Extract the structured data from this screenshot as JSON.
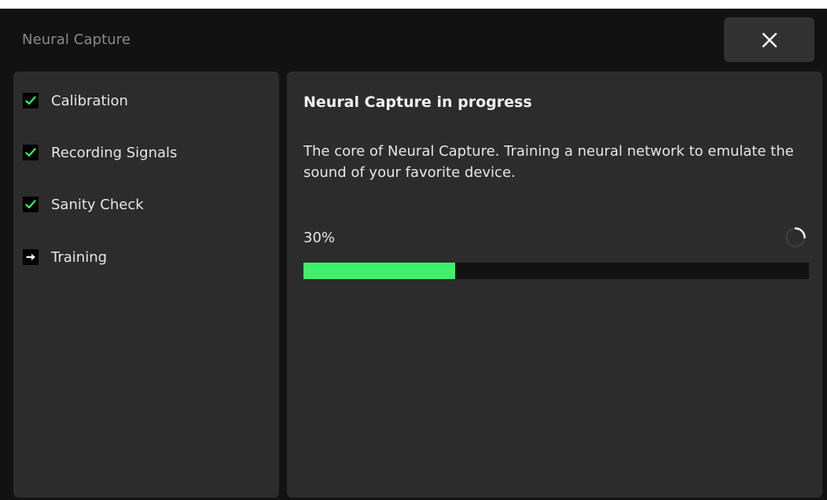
{
  "window": {
    "title": "Neural Capture"
  },
  "close_button": {
    "icon": "close-icon",
    "label": "×"
  },
  "steps": [
    {
      "label": "Calibration",
      "status": "done",
      "icon": "check-icon"
    },
    {
      "label": "Recording Signals",
      "status": "done",
      "icon": "check-icon"
    },
    {
      "label": "Sanity Check",
      "status": "done",
      "icon": "check-icon"
    },
    {
      "label": "Training",
      "status": "current",
      "icon": "arrow-right-icon"
    }
  ],
  "main": {
    "title": "Neural Capture in progress",
    "description": "The core of Neural Capture. Training a neural network to emulate the sound of your favorite device.",
    "progress_label": "30%",
    "progress_value": 0.3,
    "spinner_icon": "loading-spinner-icon"
  },
  "colors": {
    "background": "#121212",
    "panel": "#2c2c2c",
    "accent_green": "#3ef06a",
    "check_green": "#3ef06a",
    "text": "#e6e6e6",
    "muted_text": "#8a8a8a"
  }
}
